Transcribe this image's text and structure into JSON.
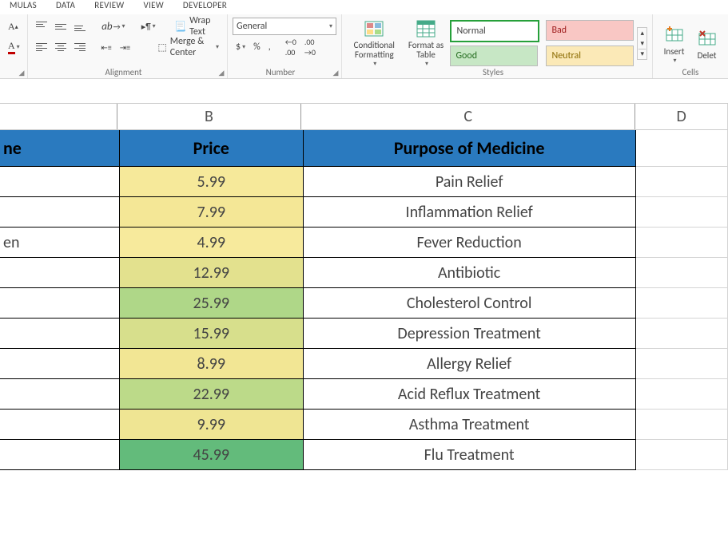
{
  "ribbon_tabs": [
    "MULAS",
    "DATA",
    "REVIEW",
    "VIEW",
    "DEVELOPER"
  ],
  "alignment": {
    "wrap_text": "Wrap Text",
    "merge_center": "Merge & Center",
    "group_label": "Alignment"
  },
  "number": {
    "format": "General",
    "group_label": "Number",
    "percent": "%",
    "comma": ",",
    "currency": "$",
    "inc_dec": "",
    "inc": "",
    "dec": ""
  },
  "styles": {
    "conditional": "Conditional Formatting",
    "format_as_table": "Format as Table",
    "normal": "Normal",
    "bad": "Bad",
    "good": "Good",
    "neutral": "Neutral",
    "group_label": "Styles"
  },
  "cells": {
    "insert": "Insert",
    "delete": "Delet",
    "group_label": "Cells"
  },
  "columns": {
    "a": "",
    "b": "B",
    "c": "C",
    "d": "D"
  },
  "header": {
    "a": "ne",
    "b": "Price",
    "c": "Purpose of Medicine"
  },
  "rows": [
    {
      "a": "",
      "b": "5.99",
      "c": "Pain Relief",
      "bcolor": "#f6e99a"
    },
    {
      "a": "",
      "b": "7.99",
      "c": "Inflammation Relief",
      "bcolor": "#f4e796"
    },
    {
      "a": "en",
      "b": "4.99",
      "c": "Fever Reduction",
      "bcolor": "#f7ea9c"
    },
    {
      "a": "",
      "b": "12.99",
      "c": "Antibiotic",
      "bcolor": "#e3e18e"
    },
    {
      "a": "",
      "b": "25.99",
      "c": "Cholesterol Control",
      "bcolor": "#afd788"
    },
    {
      "a": "",
      "b": "15.99",
      "c": "Depression Treatment",
      "bcolor": "#d7df8c"
    },
    {
      "a": "",
      "b": "8.99",
      "c": "Allergy Relief",
      "bcolor": "#f2e694"
    },
    {
      "a": "",
      "b": "22.99",
      "c": "Acid Reflux Treatment",
      "bcolor": "#bcda89"
    },
    {
      "a": "",
      "b": "9.99",
      "c": "Asthma Treatment",
      "bcolor": "#efe593"
    },
    {
      "a": "",
      "b": "45.99",
      "c": "Flu Treatment",
      "bcolor": "#63bb7b"
    }
  ]
}
